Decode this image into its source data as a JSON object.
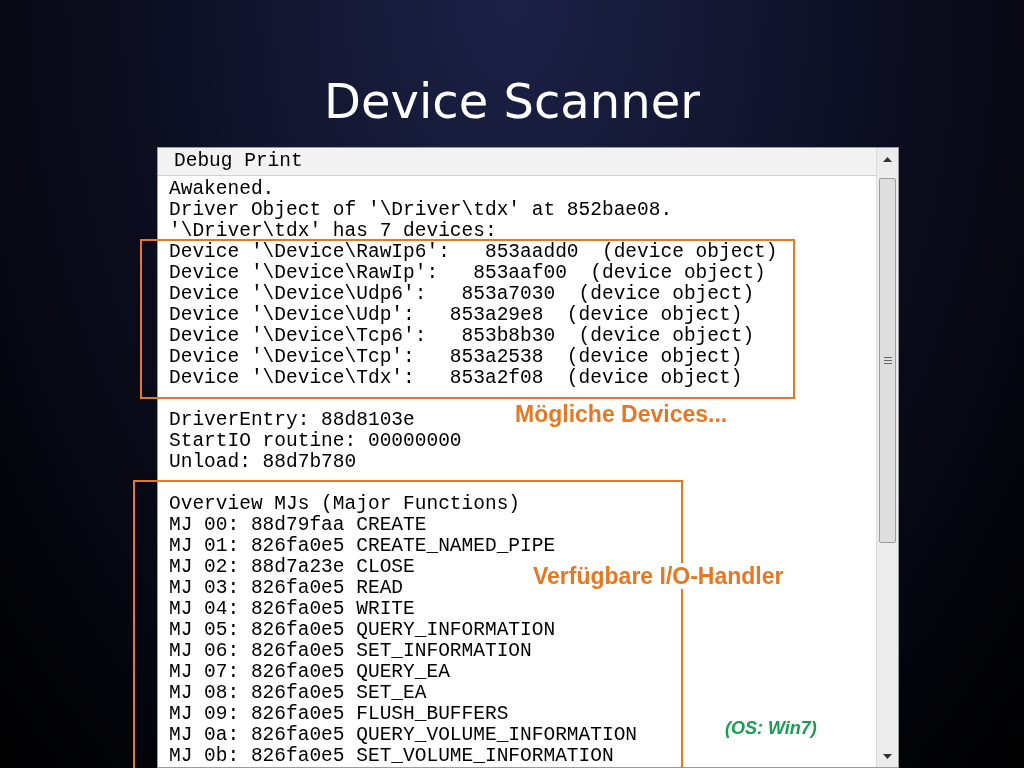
{
  "slide_title": "Device Scanner",
  "window": {
    "header": "Debug Print",
    "sections": [
      [
        "Awakened.",
        "Driver Object of '\\Driver\\tdx' at 852bae08.",
        "'\\Driver\\tdx' has 7 devices:",
        "Device '\\Device\\RawIp6':   853aadd0  (device object)",
        "Device '\\Device\\RawIp':   853aaf00  (device object)",
        "Device '\\Device\\Udp6':   853a7030  (device object)",
        "Device '\\Device\\Udp':   853a29e8  (device object)",
        "Device '\\Device\\Tcp6':   853b8b30  (device object)",
        "Device '\\Device\\Tcp':   853a2538  (device object)",
        "Device '\\Device\\Tdx':   853a2f08  (device object)"
      ],
      [
        "DriverEntry: 88d8103e",
        "StartIO routine: 00000000",
        "Unload: 88d7b780"
      ],
      [
        "Overview MJs (Major Functions)",
        "MJ 00: 88d79faa CREATE",
        "MJ 01: 826fa0e5 CREATE_NAMED_PIPE",
        "MJ 02: 88d7a23e CLOSE",
        "MJ 03: 826fa0e5 READ",
        "MJ 04: 826fa0e5 WRITE",
        "MJ 05: 826fa0e5 QUERY_INFORMATION",
        "MJ 06: 826fa0e5 SET_INFORMATION",
        "MJ 07: 826fa0e5 QUERY_EA",
        "MJ 08: 826fa0e5 SET_EA",
        "MJ 09: 826fa0e5 FLUSH_BUFFERS",
        "MJ 0a: 826fa0e5 QUERY_VOLUME_INFORMATION",
        "MJ 0b: 826fa0e5 SET_VOLUME_INFORMATION"
      ]
    ]
  },
  "annotations": [
    {
      "text": "Mögliche Devices...",
      "color": "#e87722"
    },
    {
      "text": "Verfügbare I/O-Handler",
      "color": "#e87722"
    },
    {
      "text": "(OS: Win7)",
      "color": "#14a050"
    }
  ]
}
